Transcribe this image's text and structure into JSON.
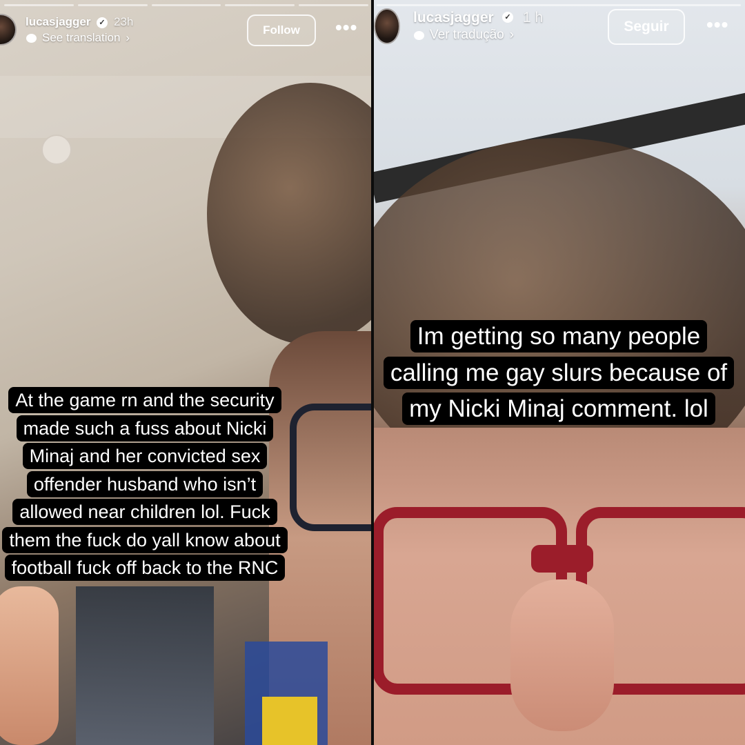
{
  "left_story": {
    "username": "lucasjagger",
    "time": "23h",
    "translate_label": "See translation",
    "follow_label": "Follow",
    "more_label": "•••",
    "caption": "At the game rn and the security made such a fuss about Nicki Minaj and her convicted sex offender husband who isn’t allowed near children lol. Fuck them the fuck do yall know about football fuck off back to the RNC"
  },
  "right_story": {
    "username": "lucasjagger",
    "time": "1 h",
    "translate_label": "Ver tradução",
    "follow_label": "Seguir",
    "more_label": "•••",
    "caption": "Im getting so many people calling me gay slurs because of my Nicki Minaj comment. lol"
  },
  "icons": {
    "verified": "verified-badge-icon",
    "translate": "speech-bubble-icon",
    "chevron": "chevron-right-icon",
    "more": "more-options-icon"
  },
  "colors": {
    "caption_bg": "#000000",
    "caption_text": "#ffffff",
    "header_text": "#ffffff"
  }
}
